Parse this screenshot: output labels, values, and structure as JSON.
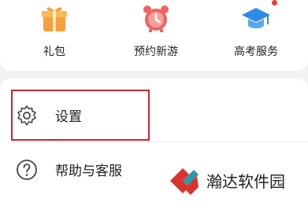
{
  "shortcuts": [
    {
      "label": "礼包",
      "icon": "gift-icon",
      "color": "#f5a03a"
    },
    {
      "label": "预约新游",
      "icon": "alarm-clock-icon",
      "color": "#f0625e"
    },
    {
      "label": "高考服务",
      "icon": "graduation-cap-icon",
      "color": "#2f8be6",
      "badge": true
    }
  ],
  "list": [
    {
      "label": "设置",
      "icon": "gear-icon"
    },
    {
      "label": "帮助与客服",
      "icon": "help-circle-icon"
    }
  ],
  "highlight_color": "#c8262c",
  "watermark": {
    "text": "瀚达软件园",
    "logo": "watermark-logo-icon"
  }
}
